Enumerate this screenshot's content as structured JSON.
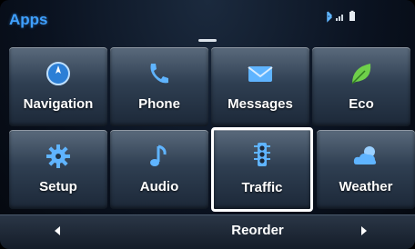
{
  "header": {
    "title": "Apps"
  },
  "tiles": [
    {
      "label": "Navigation",
      "icon": "compass-icon"
    },
    {
      "label": "Phone",
      "icon": "phone-icon"
    },
    {
      "label": "Messages",
      "icon": "envelope-icon"
    },
    {
      "label": "Eco",
      "icon": "leaf-icon"
    },
    {
      "label": "Setup",
      "icon": "gear-icon"
    },
    {
      "label": "Audio",
      "icon": "music-note-icon"
    },
    {
      "label": "Traffic",
      "icon": "traffic-light-icon",
      "selected": true
    },
    {
      "label": "Weather",
      "icon": "cloud-sun-icon"
    }
  ],
  "bottom": {
    "reorder_label": "Reorder",
    "prev_icon": "arrow-left-icon",
    "next_icon": "arrow-right-icon"
  },
  "colors": {
    "accent": "#3fa0ff",
    "icon_blue": "#5fb4ff",
    "eco_green": "#6fd04a",
    "selection": "#ffffff"
  }
}
